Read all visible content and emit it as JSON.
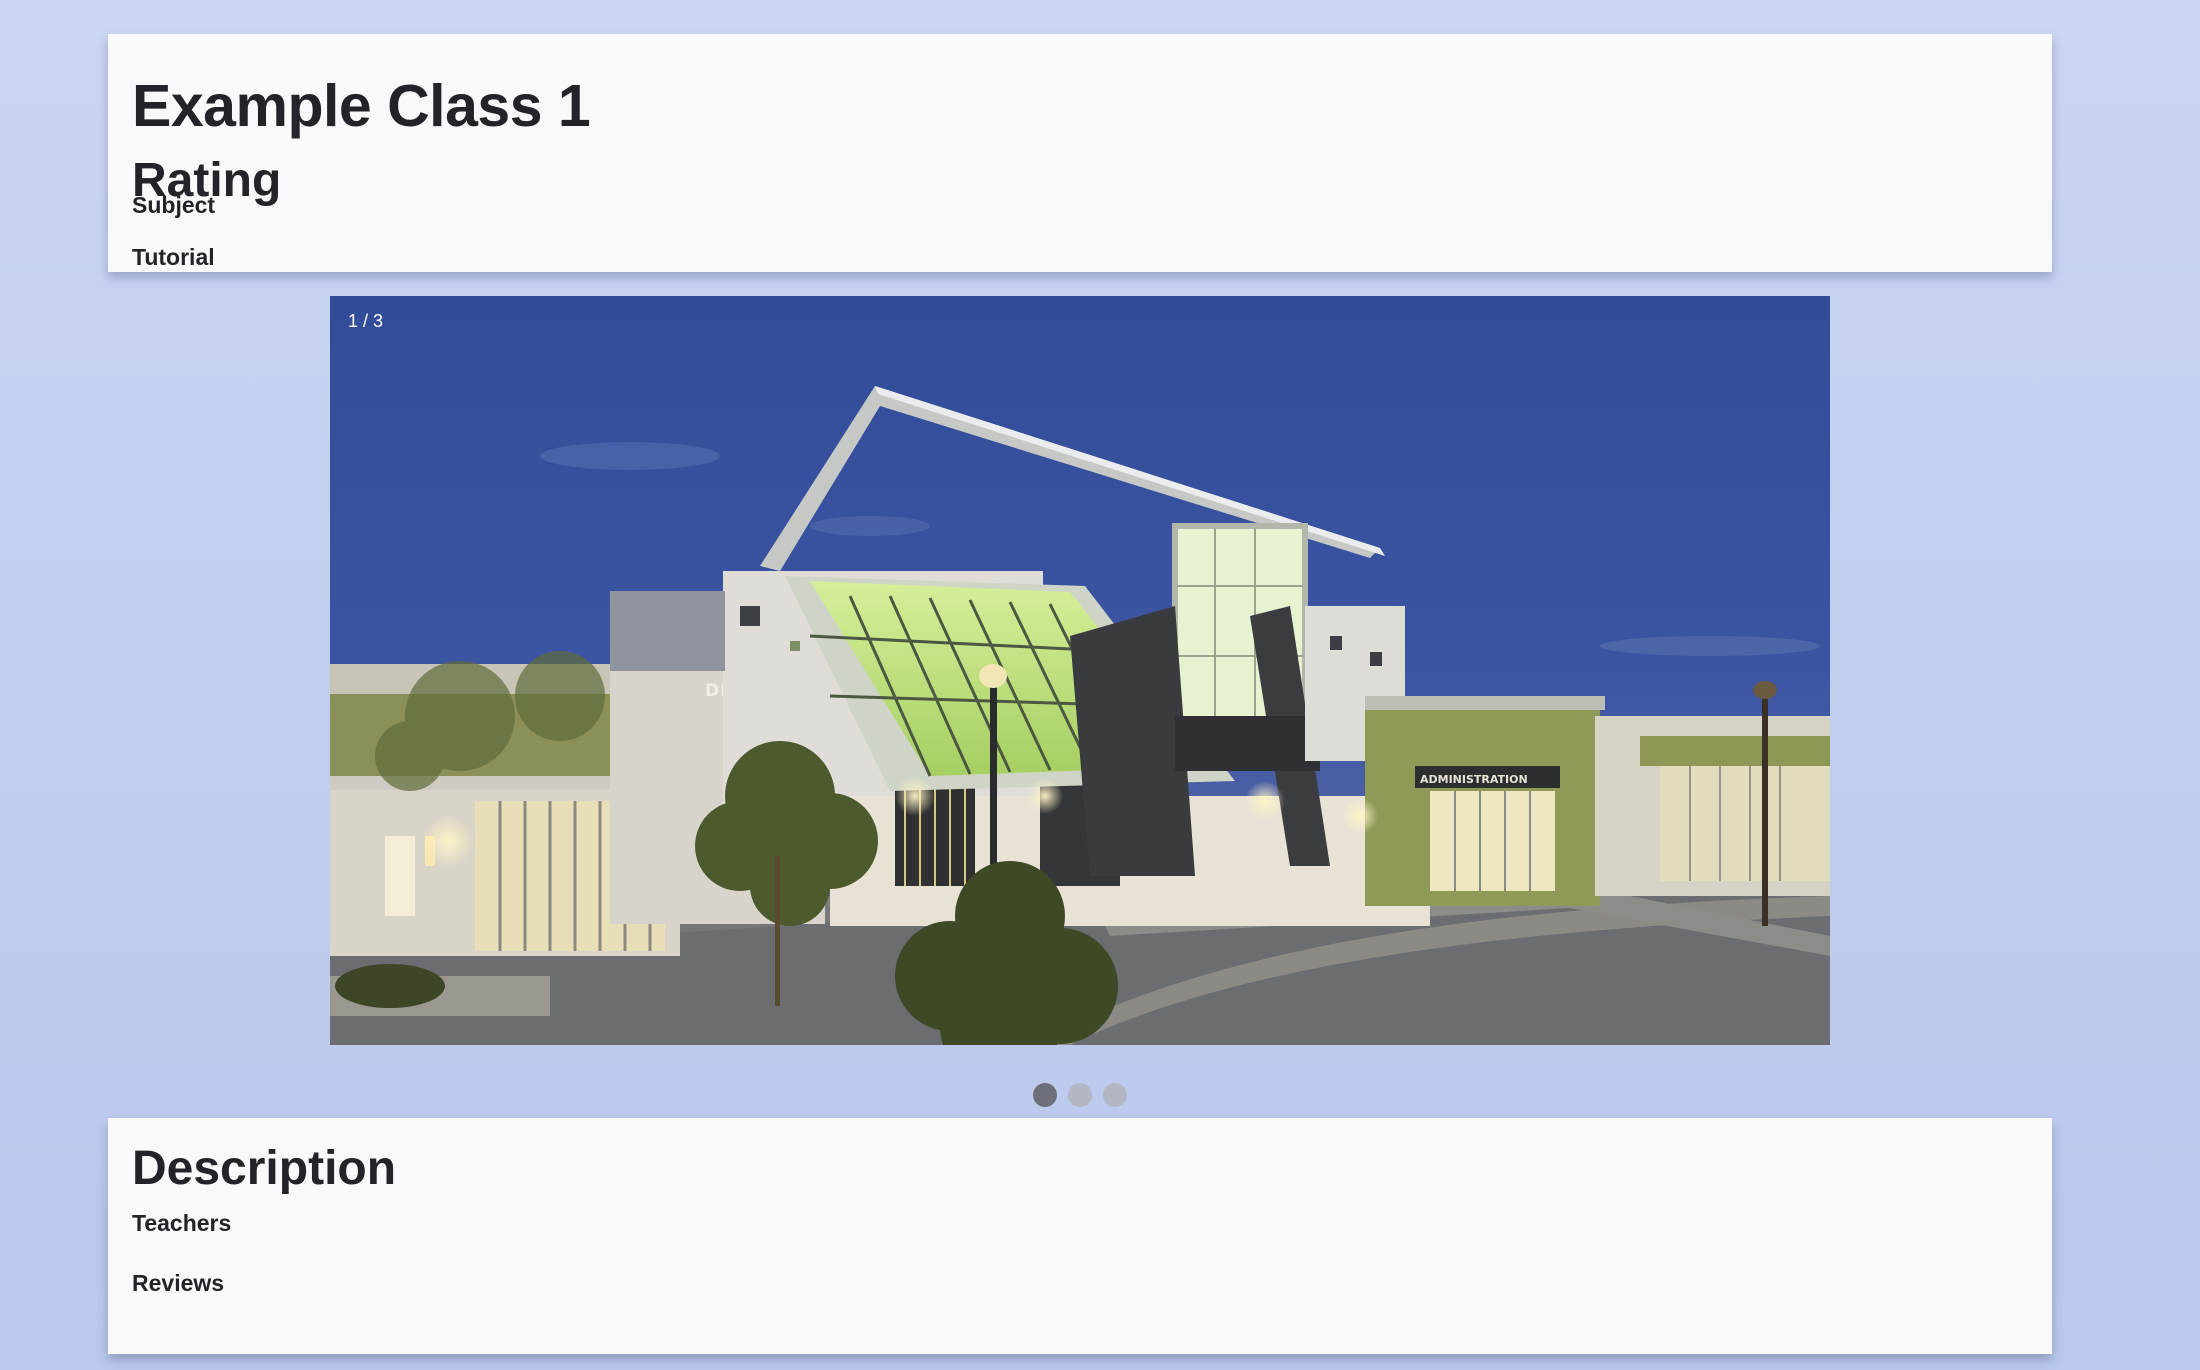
{
  "header": {
    "title": "Example Class 1",
    "rating_label": "Rating",
    "subject_label": "Subject",
    "tutorial_label": "Tutorial"
  },
  "carousel": {
    "counter": "1 / 3",
    "image_sign_text": "DEL NORTE",
    "image_sign_text_2": "ADMINISTRATION",
    "slide_count": 3,
    "active_index": 0
  },
  "details": {
    "description_label": "Description",
    "teachers_label": "Teachers",
    "reviews_label": "Reviews"
  },
  "colors": {
    "page_background": "#c4d1ef",
    "card_background": "#f8f9fa",
    "text": "#212529",
    "dot_active": "#6e7079",
    "dot_inactive": "#b3b7c4"
  }
}
